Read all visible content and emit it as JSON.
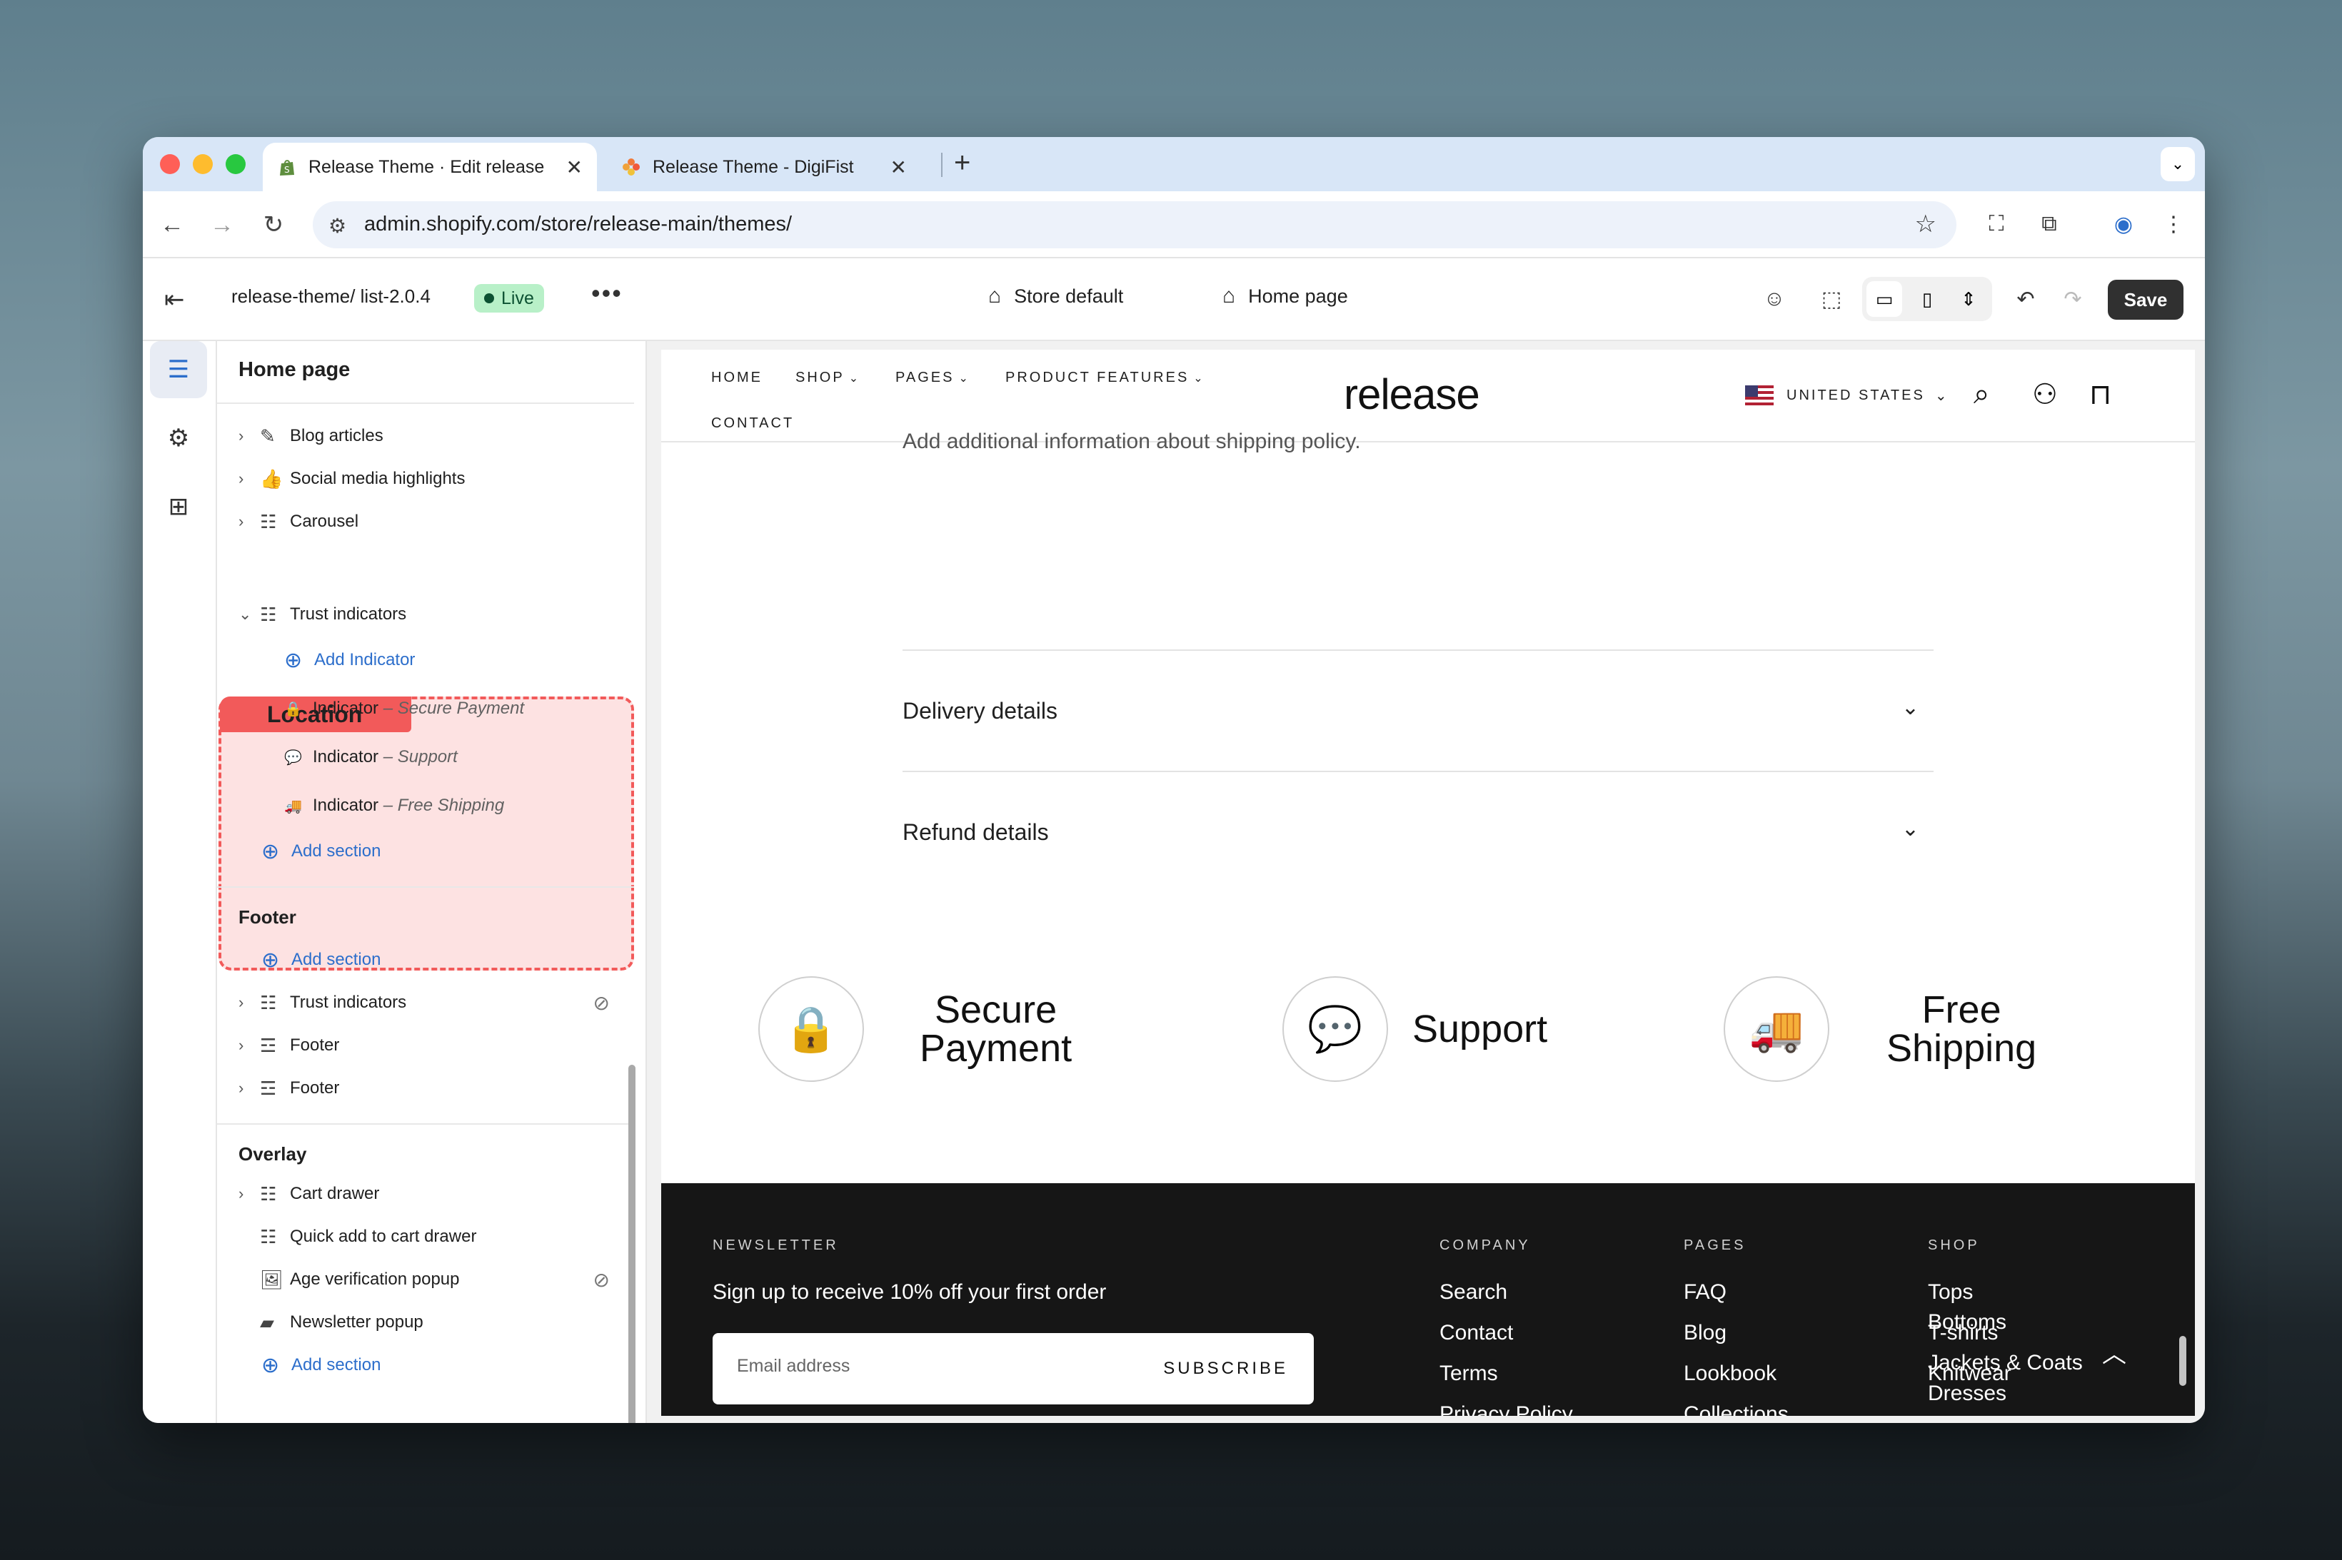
{
  "browser": {
    "tabs": [
      {
        "title": "Release Theme · Edit release",
        "active": true
      },
      {
        "title": "Release Theme - DigiFist",
        "active": false
      }
    ],
    "url": "admin.shopify.com/store/release-main/themes/"
  },
  "editor": {
    "theme_name": "release-theme/ list-2.0.4",
    "live_label": "Live",
    "store_default": "Store default",
    "page_label": "Home page",
    "save_label": "Save"
  },
  "sidebar": {
    "title": "Home page",
    "template_items": [
      "Blog articles",
      "Social media highlights",
      "Carousel"
    ],
    "highlight_tag": "Location",
    "trust": {
      "label": "Trust indicators",
      "add_label": "Add Indicator",
      "indicators": [
        {
          "label": "Indicator",
          "detail": "– Secure Payment"
        },
        {
          "label": "Indicator",
          "detail": "– Support"
        },
        {
          "label": "Indicator",
          "detail": "– Free Shipping"
        }
      ]
    },
    "add_section": "Add section",
    "footer_group": {
      "title": "Footer",
      "add_section": "Add section",
      "items": [
        "Trust indicators",
        "Footer",
        "Footer"
      ]
    },
    "overlay_group": {
      "title": "Overlay",
      "items": [
        "Cart drawer",
        "Quick add to cart drawer",
        "Age verification popup",
        "Newsletter popup"
      ],
      "add_section": "Add section"
    }
  },
  "store": {
    "nav": {
      "home": "HOME",
      "shop": "SHOP",
      "pages": "PAGES",
      "product_features": "PRODUCT FEATURES",
      "contact": "CONTACT"
    },
    "logo": "release",
    "country": "UNITED STATES",
    "faq_text": "Add additional information about shipping policy.",
    "faq": [
      "Delivery details",
      "Refund details"
    ],
    "trust": [
      {
        "line1": "Secure",
        "line2": "Payment"
      },
      {
        "line1": "Support",
        "line2": ""
      },
      {
        "line1": "Free",
        "line2": "Shipping"
      }
    ],
    "footer": {
      "newsletter_title": "NEWSLETTER",
      "newsletter_lead": "Sign up to receive 10% off your first order",
      "email_placeholder": "Email address",
      "subscribe": "SUBSCRIBE",
      "columns": [
        {
          "title": "COMPANY",
          "links": [
            "Search",
            "Contact",
            "Terms",
            "Privacy Policy"
          ]
        },
        {
          "title": "PAGES",
          "links": [
            "FAQ",
            "Blog",
            "Lookbook",
            "Collections"
          ]
        },
        {
          "title": "SHOP",
          "links": [
            "Tops",
            "T-shirts",
            "Knitwear",
            "Dresses",
            "Bottoms",
            "Jackets & Coats"
          ]
        }
      ]
    }
  },
  "colors": {
    "accent": "#2c6ecb",
    "live_bg": "#b8f0c8",
    "highlight": "#f25a5a",
    "footer_bg": "#161616"
  }
}
